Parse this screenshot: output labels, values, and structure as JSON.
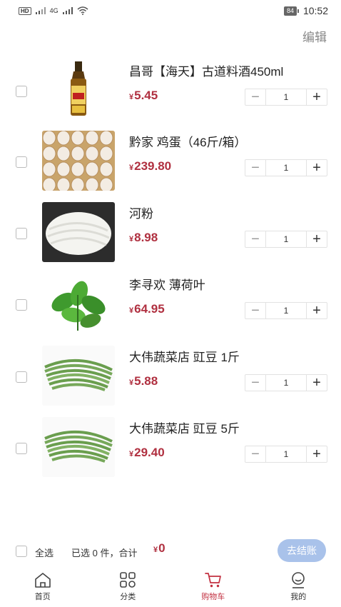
{
  "status_bar": {
    "network_left": "HD",
    "signal_label": "4G",
    "battery": "84",
    "time": "10:52"
  },
  "header": {
    "edit_label": "编辑"
  },
  "currency_symbol": "¥",
  "cart": {
    "items": [
      {
        "name": "昌哥【海天】古道料酒450ml",
        "price": "5.45",
        "quantity": "1",
        "image": "cooking-wine-bottle"
      },
      {
        "name": "黔家 鸡蛋（46斤/箱）",
        "price": "239.80",
        "quantity": "1",
        "image": "eggs-tray"
      },
      {
        "name": "河粉",
        "price": "8.98",
        "quantity": "1",
        "image": "rice-noodles"
      },
      {
        "name": "李寻欢 薄荷叶",
        "price": "64.95",
        "quantity": "1",
        "image": "mint-leaves"
      },
      {
        "name": "大伟蔬菜店 豇豆 1斤",
        "price": "5.88",
        "quantity": "1",
        "image": "long-beans"
      },
      {
        "name": "大伟蔬菜店 豇豆 5斤",
        "price": "29.40",
        "quantity": "1",
        "image": "long-beans"
      }
    ]
  },
  "footer": {
    "select_all_label": "全选",
    "summary_label": "已选 0 件，合计",
    "total": "0",
    "checkout_label": "去结账"
  },
  "tabs": [
    {
      "label": "首页",
      "icon": "home-icon",
      "active": false
    },
    {
      "label": "分类",
      "icon": "category-icon",
      "active": false
    },
    {
      "label": "购物车",
      "icon": "cart-icon",
      "active": true
    },
    {
      "label": "我的",
      "icon": "profile-icon",
      "active": false
    }
  ],
  "colors": {
    "price": "#b03040",
    "active_tab": "#c23040",
    "checkout_button": "#a9c2ea"
  }
}
